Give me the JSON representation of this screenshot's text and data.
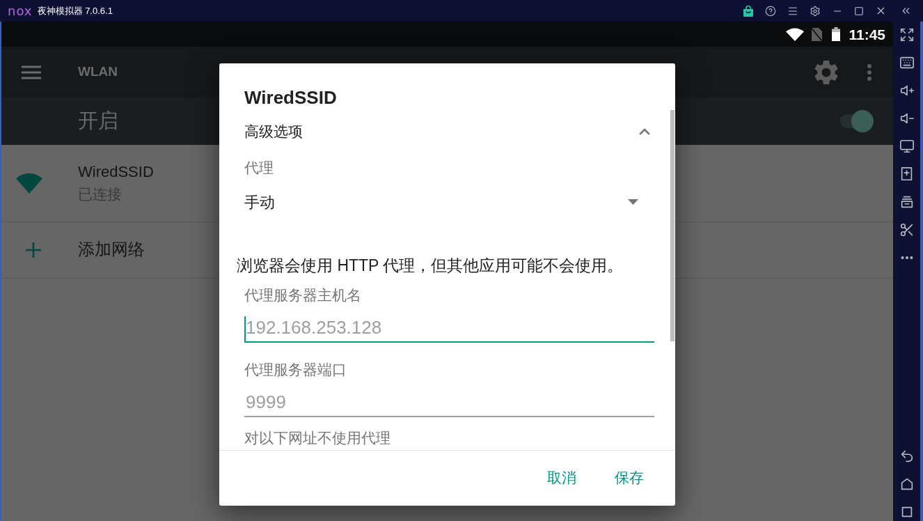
{
  "emulator_window": {
    "logo": "nox",
    "title": "夜神模拟器 7.0.6.1"
  },
  "status_bar": {
    "time": "11:45"
  },
  "app_bar": {
    "title": "WLAN"
  },
  "wlan_switch": {
    "label": "开启",
    "on": true
  },
  "networks": [
    {
      "kind": "network",
      "name": "WiredSSID",
      "status": "已连接"
    },
    {
      "kind": "add",
      "name": "添加网络"
    }
  ],
  "dialog": {
    "title": "WiredSSID",
    "advanced": {
      "label": "高级选项",
      "expanded": true
    },
    "proxy": {
      "label": "代理",
      "value": "手动"
    },
    "note": "浏览器会使用 HTTP 代理，但其他应用可能不会使用。",
    "fields": [
      {
        "label": "代理服务器主机名",
        "placeholder": "192.168.253.128",
        "focused": true
      },
      {
        "label": "代理服务器端口",
        "placeholder": "9999",
        "focused": false
      }
    ],
    "cut_label": "对以下网址不使用代理",
    "buttons": [
      "取消",
      "保存"
    ]
  }
}
